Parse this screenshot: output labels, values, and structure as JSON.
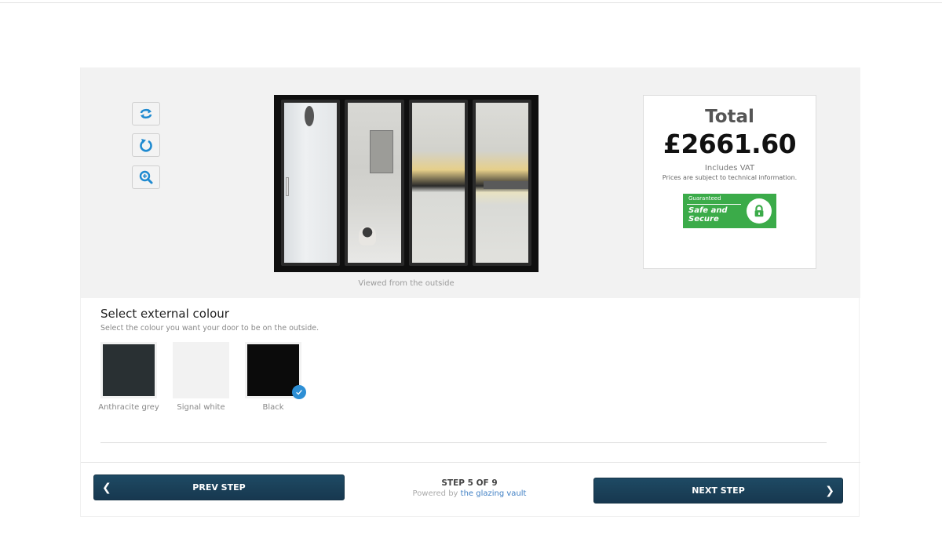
{
  "toolbar": {
    "icons": [
      "rotate-arrows-icon",
      "reset-rotation-icon",
      "zoom-in-icon"
    ]
  },
  "preview": {
    "caption": "Viewed from the outside"
  },
  "total": {
    "label": "Total",
    "price": "£2661.60",
    "vat_note": "Includes VAT",
    "tech_note": "Prices are subject to technical information.",
    "badge": {
      "small": "Guaranteed",
      "line1": "Safe and",
      "line2": "Secure",
      "color": "#3bab49"
    }
  },
  "colour_selection": {
    "title": "Select external colour",
    "subtitle": "Select the colour you want your door to be on the outside.",
    "options": [
      {
        "label": "Anthracite grey",
        "color": "#293033",
        "selected": false
      },
      {
        "label": "Signal white",
        "color": "#f2f2f2",
        "selected": false
      },
      {
        "label": "Black",
        "color": "#0b0b0b",
        "selected": true
      }
    ],
    "check_color": "#2d8fd5"
  },
  "footer": {
    "prev_label": "PREV STEP",
    "next_label": "NEXT STEP",
    "step_text": "STEP 5 OF 9",
    "powered_prefix": "Powered by",
    "powered_link": "the glazing vault",
    "button_color": "#1b425b"
  }
}
